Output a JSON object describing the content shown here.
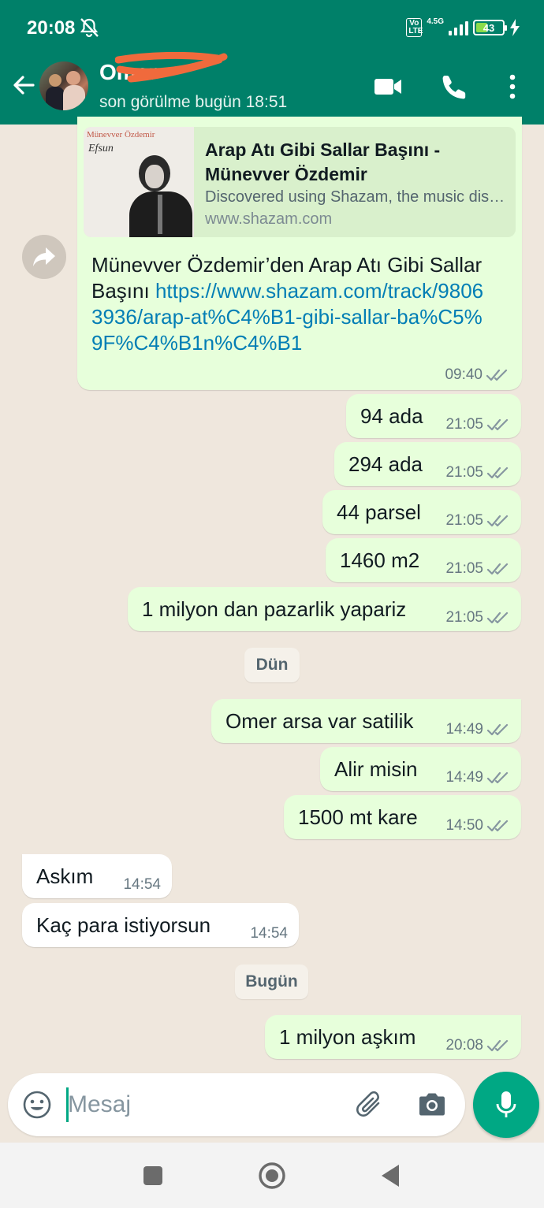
{
  "status_bar": {
    "time": "20:08",
    "volte": "Vo LTE",
    "network": "4.5G",
    "battery": "43",
    "battery_level": 0.43
  },
  "header": {
    "contact_name": "Omer",
    "last_seen": "son görülme bugün 18:51"
  },
  "shared_link": {
    "thumb_artist": "Münevver Özdemir",
    "thumb_album": "Efsun",
    "title": "Arap Atı Gibi Sallar Başını - Münevver Özdemir",
    "description": "Discovered using Shazam, the music discovery app",
    "site": "www.shazam.com",
    "text": "Münevver Özdemir’den Arap Atı Gibi Sallar Başını",
    "url": "https://www.shazam.com/track/98063936/arap-at%C4%B1-gibi-sallar-ba%C5%9F%C4%B1n%C4%B1",
    "time": "09:40"
  },
  "messages": [
    {
      "text": "94 ada",
      "time": "21:05"
    },
    {
      "text": "294 ada",
      "time": "21:05"
    },
    {
      "text": "44 parsel",
      "time": "21:05"
    },
    {
      "text": "1460 m2",
      "time": "21:05"
    },
    {
      "text": "1 milyon dan pazarlik yapariz",
      "time": "21:05"
    },
    {
      "text": "Omer arsa var satilik",
      "time": "14:49"
    },
    {
      "text": "Alir misin",
      "time": "14:49"
    },
    {
      "text": "1500 mt kare",
      "time": "14:50"
    },
    {
      "text": "Askım",
      "time": "14:54"
    },
    {
      "text": "Kaç para istiyorsun",
      "time": "14:54"
    },
    {
      "text": "1 milyon aşkım",
      "time": "20:08"
    }
  ],
  "date_chips": [
    "Dün",
    "Bugün"
  ],
  "composer": {
    "placeholder": "Mesaj",
    "value": ""
  },
  "colors": {
    "header": "#008069",
    "outgoing_bubble": "#e7ffdb",
    "incoming_bubble": "#ffffff",
    "accent": "#00a884",
    "link": "#027eb5"
  }
}
